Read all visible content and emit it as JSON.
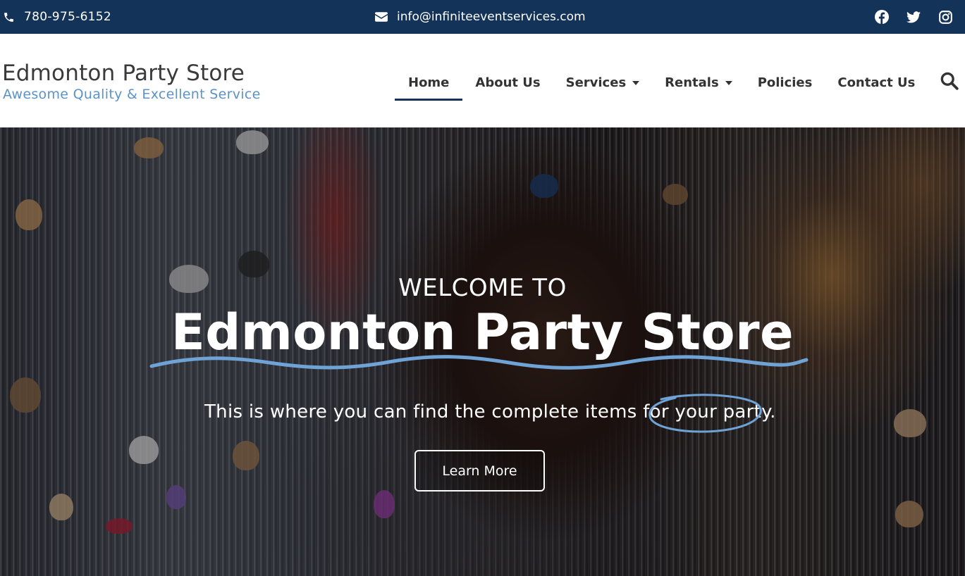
{
  "topbar": {
    "phone": "780-975-6152",
    "email": "info@infiniteeventservices.com",
    "social": [
      "facebook-icon",
      "twitter-icon",
      "instagram-icon"
    ]
  },
  "brand": {
    "title": "Edmonton Party Store",
    "tagline": "Awesome Quality & Excellent Service"
  },
  "nav": {
    "home": "Home",
    "about": "About Us",
    "services": "Services",
    "rentals": "Rentals",
    "policies": "Policies",
    "contact": "Contact Us",
    "active": "Home"
  },
  "hero": {
    "kicker": "WELCOME TO",
    "title": "Edmonton Party Store",
    "subtitle_start": "This is where you can find the complete items for ",
    "subtitle_highlight": "your party.",
    "cta": "Learn More"
  },
  "colors": {
    "topbar_bg": "#143358",
    "tagline": "#5b93c9",
    "accent": "#6fa3d6"
  }
}
